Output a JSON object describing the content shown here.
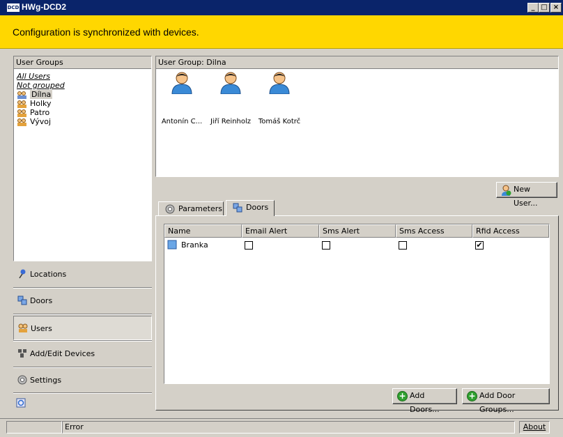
{
  "window": {
    "icon_label": "DCD",
    "title": "HWg-DCD2",
    "buttons": [
      "_",
      "□",
      "×"
    ]
  },
  "banner": {
    "text": "Configuration is synchronized with devices.",
    "color": "#ffd700"
  },
  "user_groups": {
    "header": "User Groups",
    "items": [
      {
        "label": "All Users",
        "kind": "link"
      },
      {
        "label": "Not grouped",
        "kind": "link"
      },
      {
        "label": "Dílna",
        "kind": "group",
        "selected": true
      },
      {
        "label": "Holky",
        "kind": "group"
      },
      {
        "label": "Patro",
        "kind": "group"
      },
      {
        "label": "Vývoj",
        "kind": "group"
      }
    ]
  },
  "nav": [
    {
      "label": "Locations",
      "icon": "pin-icon"
    },
    {
      "label": "Doors",
      "icon": "doors-icon"
    },
    {
      "label": "Users",
      "icon": "users-icon",
      "active": true
    },
    {
      "label": "Add/Edit Devices",
      "icon": "devices-icon"
    },
    {
      "label": "Settings",
      "icon": "gear-icon"
    }
  ],
  "group_panel": {
    "header": "User Group: Dilna",
    "users": [
      "Antonín C...",
      "Jiří Reinholz",
      "Tomáš Kotrč"
    ]
  },
  "new_user_button": "New User...",
  "tabs": [
    {
      "label": "Parameters",
      "icon": "gear-icon"
    },
    {
      "label": "Doors",
      "icon": "doors-icon",
      "active": true
    }
  ],
  "doors_table": {
    "columns": [
      "Name",
      "Email Alert",
      "Sms Alert",
      "Sms Access",
      "Rfid Access"
    ],
    "rows": [
      {
        "name": "Branka",
        "email_alert": false,
        "sms_alert": false,
        "sms_access": false,
        "rfid_access": true
      }
    ]
  },
  "add_doors_button": "Add Doors...",
  "add_door_groups_button": "Add Door Groups...",
  "status": {
    "text": "Error",
    "about": "About"
  }
}
